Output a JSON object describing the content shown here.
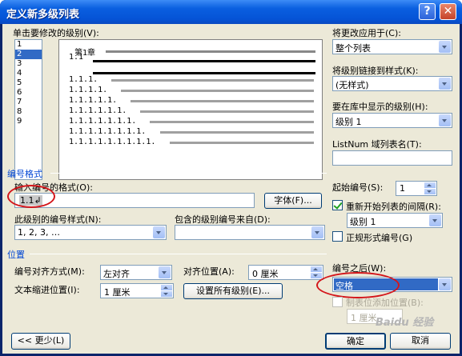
{
  "window": {
    "title": "定义新多级列表",
    "help_label": "?",
    "close_label": "✕"
  },
  "level_label": "单击要修改的级别(V):",
  "levels": [
    "1",
    "2",
    "3",
    "4",
    "5",
    "6",
    "7",
    "8",
    "9"
  ],
  "selected_level": "2",
  "preview": {
    "chapter": "第1章",
    "items": [
      "1.1",
      "1.1.1.",
      "1.1.1.1.",
      "1.1.1.1.1.",
      "1.1.1.1.1.1.",
      "1.1.1.1.1.1.1.",
      "1.1.1.1.1.1.1.1.",
      "1.1.1.1.1.1.1.1.1."
    ]
  },
  "apply_to": {
    "label": "将更改应用于(C):",
    "value": "整个列表"
  },
  "link_style": {
    "label": "将级别链接到样式(K):",
    "value": "(无样式)"
  },
  "gallery_level": {
    "label": "要在库中显示的级别(H):",
    "value": "级别 1"
  },
  "listnum": {
    "label": "ListNum 域列表名(T):",
    "value": ""
  },
  "number_format_section": "编号格式",
  "format_input": {
    "label": "输入编号的格式(O):",
    "value": "1.1↲"
  },
  "font_button": "字体(F)...",
  "start_at": {
    "label": "起始编号(S):",
    "value": "1"
  },
  "restart": {
    "label": "重新开始列表的间隔(R):",
    "value": "级别 1",
    "checked": true
  },
  "number_style": {
    "label": "此级别的编号样式(N):",
    "value": "1, 2, 3, …"
  },
  "include_level": {
    "label": "包含的级别编号来自(D):",
    "value": ""
  },
  "legal_style": {
    "label": "正规形式编号(G)",
    "checked": false
  },
  "position_section": "位置",
  "alignment": {
    "label": "编号对齐方式(M):",
    "value": "左对齐"
  },
  "align_at": {
    "label": "对齐位置(A):",
    "value": "0 厘米"
  },
  "text_indent": {
    "label": "文本缩进位置(I):",
    "value": "1 厘米"
  },
  "set_all_button": "设置所有级别(E)...",
  "follow_with": {
    "label": "编号之后(W):",
    "value": "空格"
  },
  "tab_stop": {
    "label": "制表位添加位置(B):",
    "value": "1 厘米",
    "checked": false
  },
  "less_button": "<< 更少(L)",
  "ok_button": "确定",
  "cancel_button": "取消",
  "watermark": "Baidu 经验",
  "colors": {
    "title_bar": "#0553d6",
    "highlight": "#316ac5",
    "annotation": "#d4161b"
  }
}
